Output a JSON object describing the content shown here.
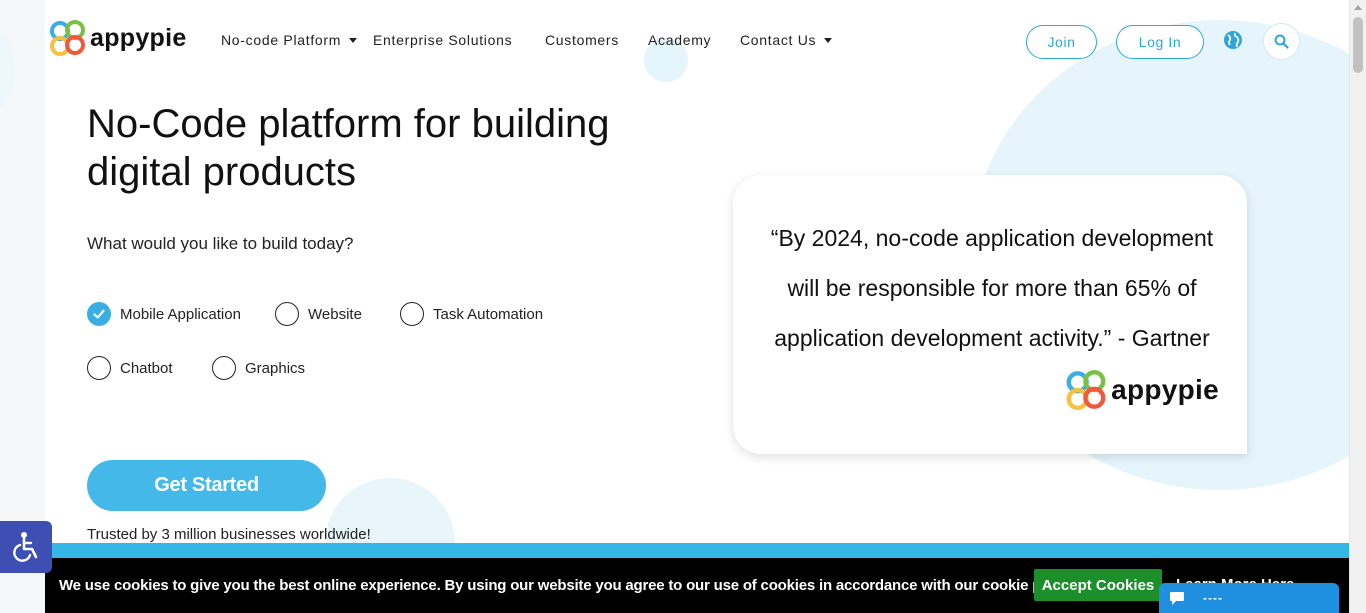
{
  "brand": {
    "name": "appypie"
  },
  "nav": {
    "items": [
      {
        "label": "No-code Platform",
        "has_dropdown": true
      },
      {
        "label": "Enterprise Solutions",
        "has_dropdown": false
      },
      {
        "label": "Customers",
        "has_dropdown": false
      },
      {
        "label": "Academy",
        "has_dropdown": false
      },
      {
        "label": "Contact Us",
        "has_dropdown": true
      }
    ],
    "join_label": "Join",
    "login_label": "Log In",
    "globe_icon": "globe-icon",
    "search_icon": "search-icon"
  },
  "hero": {
    "title_line1": "No-Code platform for building",
    "title_line2": "digital products",
    "prompt": "What would you like to build today?",
    "options": [
      {
        "label": "Mobile Application",
        "selected": true
      },
      {
        "label": "Website",
        "selected": false
      },
      {
        "label": "Task Automation",
        "selected": false
      },
      {
        "label": "Chatbot",
        "selected": false
      },
      {
        "label": "Graphics",
        "selected": false
      }
    ],
    "cta_label": "Get Started",
    "trusted_text": "Trusted by 3 million businesses worldwide!"
  },
  "quote": {
    "line1": "“By 2024, no-code application development",
    "line2": "will be responsible for more than 65% of",
    "line3": "application development activity.” - Gartner",
    "logo_text": "appypie"
  },
  "cookie": {
    "text": "We use cookies to give you the best online experience. By using our website you agree to our use of cookies in accordance with our cookie policy.",
    "accept_label": "Accept Cookies",
    "learn_more_label": "Learn More Here"
  },
  "chat": {
    "label": "----"
  },
  "colors": {
    "accent": "#45b8ea",
    "accent_dark": "#2da6d9",
    "cookie_accept": "#1d8f2a",
    "accessibility": "#3d4fb2",
    "chat": "#1f8fe0"
  }
}
